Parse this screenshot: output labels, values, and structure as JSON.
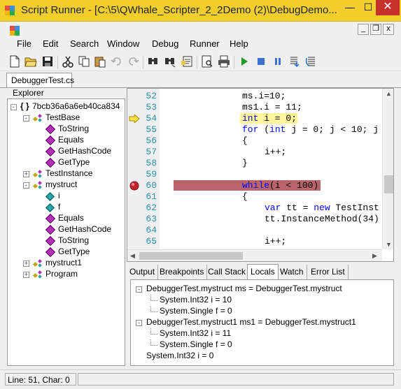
{
  "window": {
    "title": "Script Runner - [C:\\5\\QWhale_Scripter_2_2Demo (2)\\DebugDemo...",
    "minimize_glyph": "—",
    "maximize_glyph": "☐",
    "close_glyph": "✕"
  },
  "mdi": {
    "minimize_glyph": "_",
    "restore_glyph": "❐",
    "close_glyph": "x"
  },
  "menu": [
    "File",
    "Edit",
    "Search",
    "Window",
    "Debug",
    "Runner",
    "Help"
  ],
  "toolbar": {
    "icons": [
      "new-file-icon",
      "open-folder-icon",
      "save-icon",
      "cut-icon",
      "copy-icon",
      "paste-icon",
      "undo-icon",
      "redo-icon",
      "find-icon",
      "find-next-icon",
      "replace-icon",
      "print-preview-icon",
      "print-icon",
      "run-icon",
      "stop-icon",
      "pause-icon",
      "step-into-icon",
      "step-over-icon"
    ]
  },
  "document_tab": "DebuggerTest.cs",
  "explorer": {
    "label": "Explorer",
    "tree": [
      {
        "label": "7bcb36a6a6eb40ca834",
        "kind": "namespace",
        "indent": 0,
        "toggle": "-"
      },
      {
        "label": "TestBase",
        "kind": "class",
        "indent": 1,
        "toggle": "-"
      },
      {
        "label": "ToString",
        "kind": "method",
        "indent": 2
      },
      {
        "label": "Equals",
        "kind": "method",
        "indent": 2
      },
      {
        "label": "GetHashCode",
        "kind": "method",
        "indent": 2
      },
      {
        "label": "GetType",
        "kind": "method",
        "indent": 2
      },
      {
        "label": "TestInstance",
        "kind": "class",
        "indent": 1,
        "toggle": "+"
      },
      {
        "label": "mystruct",
        "kind": "class",
        "indent": 1,
        "toggle": "-"
      },
      {
        "label": "i",
        "kind": "field",
        "indent": 2
      },
      {
        "label": "f",
        "kind": "field",
        "indent": 2
      },
      {
        "label": "Equals",
        "kind": "method",
        "indent": 2
      },
      {
        "label": "GetHashCode",
        "kind": "method",
        "indent": 2
      },
      {
        "label": "ToString",
        "kind": "method",
        "indent": 2
      },
      {
        "label": "GetType",
        "kind": "method",
        "indent": 2
      },
      {
        "label": "mystruct1",
        "kind": "class",
        "indent": 1,
        "toggle": "+"
      },
      {
        "label": "Program",
        "kind": "class",
        "indent": 1,
        "toggle": "+"
      }
    ]
  },
  "editor": {
    "current_line": 54,
    "breakpoint_line": 60,
    "lines": [
      {
        "n": "52",
        "indent": 12,
        "tokens": [
          {
            "t": "ms.i=10;"
          }
        ]
      },
      {
        "n": "53",
        "indent": 12,
        "tokens": [
          {
            "t": "ms1.i = 11;"
          }
        ]
      },
      {
        "n": "54",
        "indent": 12,
        "tokens": [
          {
            "t": "int",
            "c": "kw"
          },
          {
            "t": " i = 0;"
          }
        ]
      },
      {
        "n": "55",
        "indent": 12,
        "tokens": [
          {
            "t": "for",
            "c": "kw"
          },
          {
            "t": " ("
          },
          {
            "t": "int",
            "c": "kw"
          },
          {
            "t": " j = 0; j < 10; j"
          }
        ]
      },
      {
        "n": "56",
        "indent": 12,
        "tokens": [
          {
            "t": "{"
          }
        ]
      },
      {
        "n": "57",
        "indent": 16,
        "tokens": [
          {
            "t": "i++;"
          }
        ]
      },
      {
        "n": "58",
        "indent": 12,
        "tokens": [
          {
            "t": "}"
          }
        ]
      },
      {
        "n": "59",
        "indent": 12,
        "tokens": []
      },
      {
        "n": "60",
        "indent": 12,
        "tokens": [
          {
            "t": "while",
            "c": "kw"
          },
          {
            "t": "(i < 100)"
          }
        ]
      },
      {
        "n": "61",
        "indent": 12,
        "tokens": [
          {
            "t": "{"
          }
        ]
      },
      {
        "n": "62",
        "indent": 16,
        "tokens": [
          {
            "t": "var",
            "c": "kw"
          },
          {
            "t": " tt = "
          },
          {
            "t": "new",
            "c": "kw"
          },
          {
            "t": " TestInst"
          }
        ]
      },
      {
        "n": "63",
        "indent": 16,
        "tokens": [
          {
            "t": "tt.InstanceMethod(34)"
          }
        ]
      },
      {
        "n": "64",
        "indent": 12,
        "tokens": []
      },
      {
        "n": "65",
        "indent": 16,
        "tokens": [
          {
            "t": "i++;"
          }
        ]
      }
    ]
  },
  "bottom_tabs": [
    "Output",
    "Breakpoints",
    "Call Stack",
    "Locals",
    "Watch",
    "Error List"
  ],
  "active_bottom_tab": "Locals",
  "locals": [
    {
      "label": "DebuggerTest.mystruct ms = DebuggerTest.mystruct",
      "indent": 0,
      "toggle": "-"
    },
    {
      "label": "System.Int32 i = 10",
      "indent": 1
    },
    {
      "label": "System.Single f = 0",
      "indent": 1
    },
    {
      "label": "DebuggerTest.mystruct1 ms1 = DebuggerTest.mystruct1",
      "indent": 0,
      "toggle": "-"
    },
    {
      "label": "System.Int32 i = 11",
      "indent": 1
    },
    {
      "label": "System.Single f = 0",
      "indent": 1
    },
    {
      "label": "System.Int32 i = 0",
      "indent": 0
    }
  ],
  "status": {
    "position": "Line: 51, Char: 0"
  },
  "colors": {
    "titlebar": "#f1ce2c",
    "close": "#c7312b",
    "current_line": "#fff59a",
    "breakpoint_line": "#b8646a",
    "keyword": "#0000ff",
    "line_number": "#2b91af"
  }
}
